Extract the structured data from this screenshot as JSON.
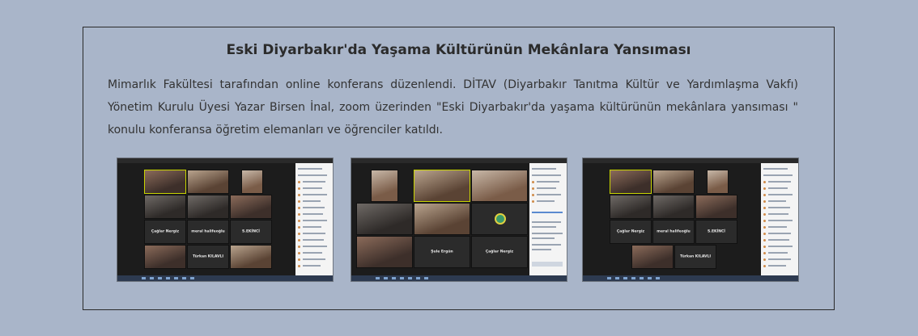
{
  "article": {
    "title": "Eski Diyarbakır'da Yaşama Kültürünün Mekânlara Yansıması",
    "body": "Mimarlık Fakültesi tarafından online konferans düzenlendi. DİTAV (Diyarbakır Tanıtma Kültür ve Yardımlaşma Vakfı) Yönetim Kurulu Üyesi Yazar Birsen İnal, zoom üzerinden \"Eski Diyarbakır'da yaşama kültürünün mekânlara yansıması \" konulu konferansa öğretim elemanları ve öğrenciler katıldı."
  },
  "photos": [
    {
      "alt": "zoom-screenshot-1",
      "names": [
        "Çağlar Nergiz",
        "meral halifeoğlu",
        "S.EKİNCİ",
        "Türkan KILAVLI"
      ]
    },
    {
      "alt": "zoom-screenshot-2",
      "names": [
        "Şule Ergün",
        "Çağlar Nergiz"
      ]
    },
    {
      "alt": "zoom-screenshot-3",
      "names": [
        "Çağlar Nergiz",
        "meral halifeoğlu",
        "S.EKİNCİ",
        "Türkan KILAVLI"
      ]
    }
  ]
}
